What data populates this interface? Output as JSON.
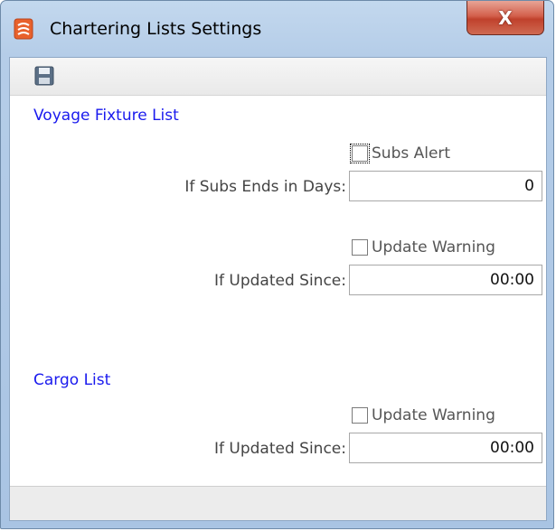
{
  "window": {
    "title": "Chartering Lists Settings",
    "close_glyph": "X"
  },
  "toolbar": {
    "save_icon": "save-icon"
  },
  "voyage_fixture_list": {
    "title": "Voyage Fixture List",
    "subs_alert_label": "Subs Alert",
    "subs_alert_checked": false,
    "subs_ends_label": "If Subs Ends in Days:",
    "subs_ends_value": "0",
    "update_warning_label": "Update Warning",
    "update_warning_checked": false,
    "updated_since_label": "If Updated Since:",
    "updated_since_value": "00:00"
  },
  "cargo_list": {
    "title": "Cargo List",
    "update_warning_label": "Update Warning",
    "update_warning_checked": false,
    "updated_since_label": "If Updated Since:",
    "updated_since_value": "00:00"
  },
  "colors": {
    "section_title": "#1a1aee",
    "titlebar": "#b5cde8",
    "close_button": "#c0412c"
  }
}
